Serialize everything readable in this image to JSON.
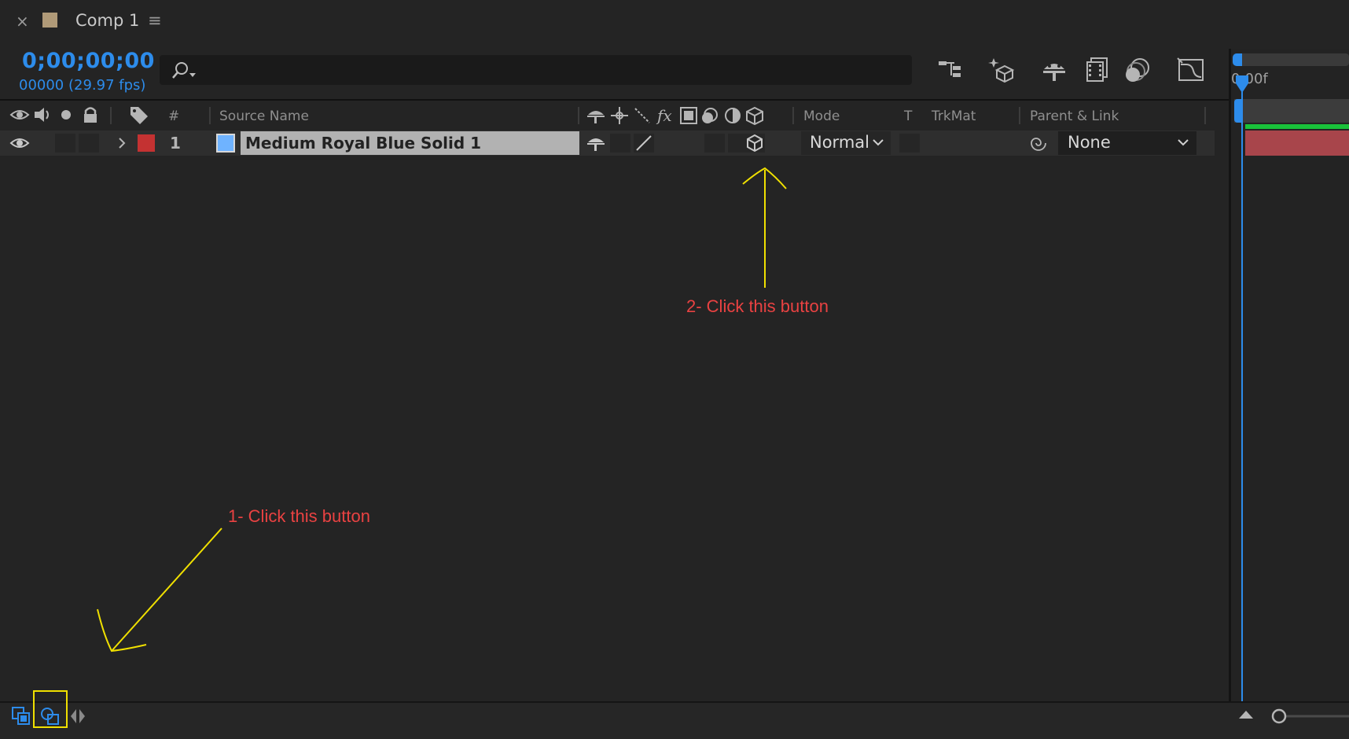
{
  "tab": {
    "close_icon": "×",
    "title": "Comp 1",
    "menu_icon": "≡",
    "swatch_color": "#b09a78"
  },
  "header": {
    "timecode": "0;00;00;00",
    "frames": "00000 (29.97 fps)",
    "search_placeholder": ""
  },
  "toolbar": {
    "icons": [
      "composition-mini-flowchart-icon",
      "draft-3d-icon",
      "shy-layers-icon",
      "frame-blending-icon",
      "motion-blur-icon",
      "graph-editor-icon"
    ]
  },
  "columns": {
    "number": "#",
    "source_name": "Source Name",
    "mode": "Mode",
    "t": "T",
    "trkmat": "TrkMat",
    "parent_link": "Parent & Link"
  },
  "layer": {
    "number": "1",
    "name": "Medium Royal Blue Solid 1",
    "mode": "Normal",
    "parent": "None",
    "label_color": "#c43232",
    "source_color": "#6fb3ff"
  },
  "timeline": {
    "time_label": "0:00f"
  },
  "annotations": {
    "step1": "1- Click this button",
    "step2": "2- Click this button",
    "color": "#e94242",
    "arrow_color": "#f0e000"
  }
}
